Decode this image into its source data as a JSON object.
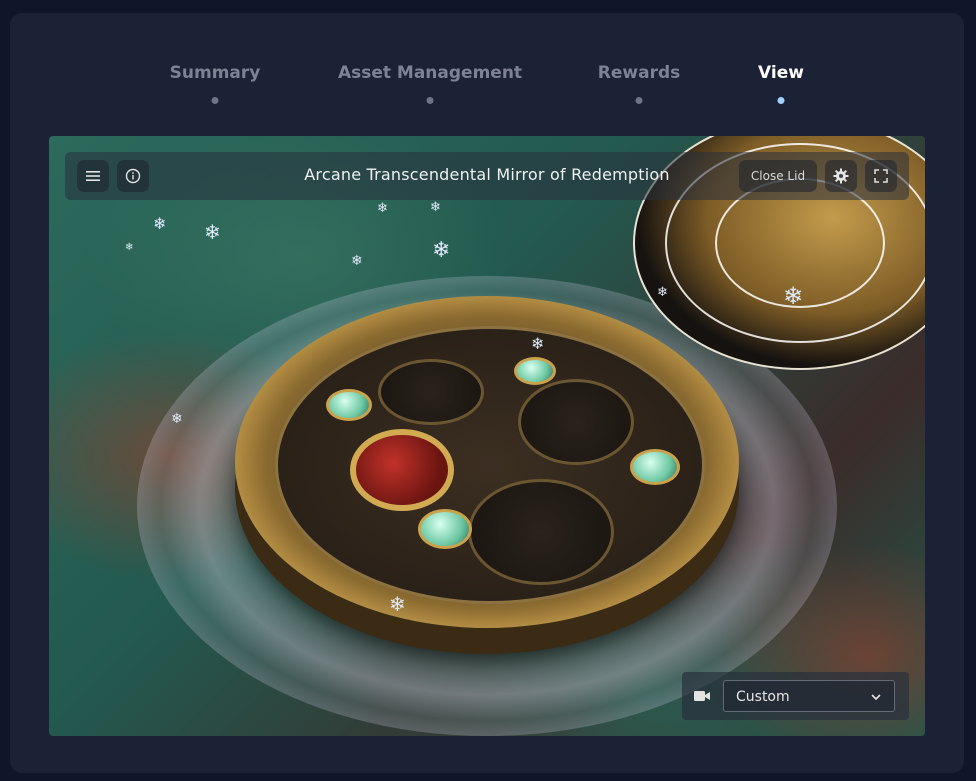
{
  "tabs": [
    {
      "label": "Summary",
      "active": false
    },
    {
      "label": "Asset Management",
      "active": false
    },
    {
      "label": "Rewards",
      "active": false
    },
    {
      "label": "View",
      "active": true
    }
  ],
  "viewer": {
    "title": "Arcane Transcendental Mirror of Redemption",
    "close_lid_label": "Close Lid",
    "camera_select": {
      "selected": "Custom"
    }
  },
  "icons": {
    "menu": "menu-icon",
    "info": "info-icon",
    "settings": "gear-icon",
    "fullscreen": "fullscreen-icon",
    "camera": "video-camera-icon",
    "dropdown": "chevron-down-icon"
  },
  "colors": {
    "page_bg": "#10162a",
    "panel_bg": "#1b2236",
    "tab_inactive": "#7d8294",
    "tab_active": "#ffffff",
    "active_dot": "#9fd3ff"
  }
}
